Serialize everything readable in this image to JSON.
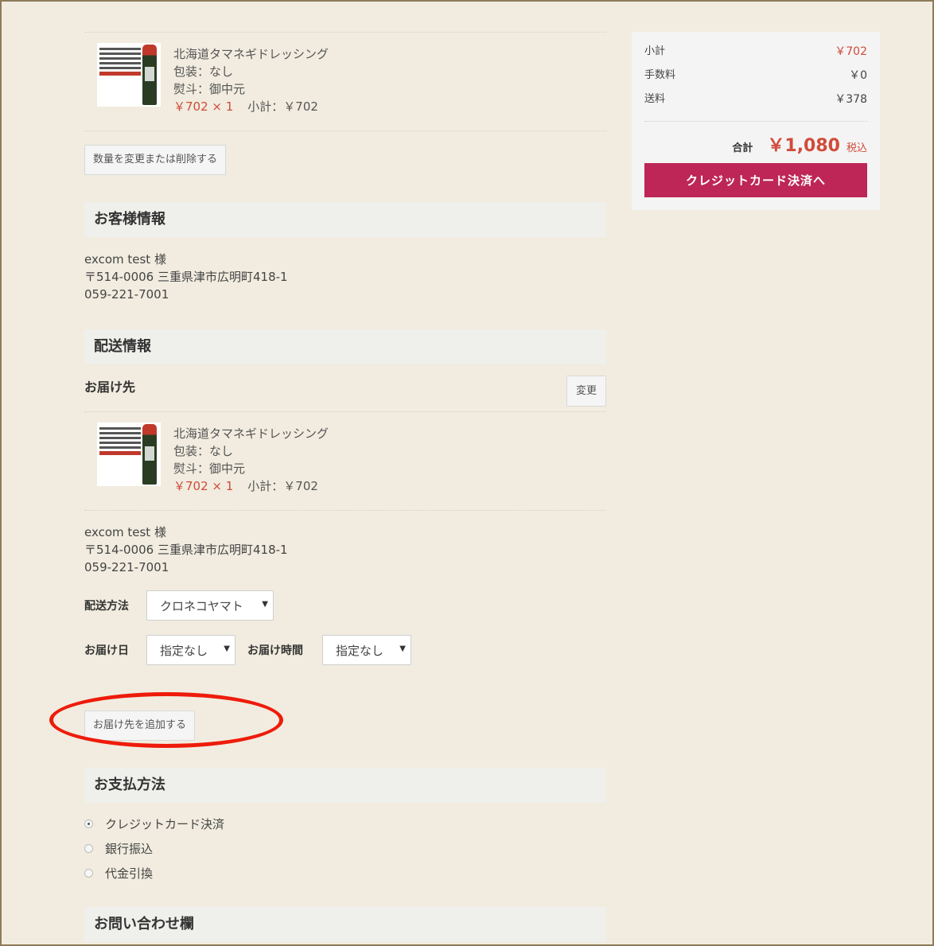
{
  "cart_item": {
    "name": "北海道タマネギドレッシング",
    "wrapping": "包装：なし",
    "noshi": "熨斗：御中元",
    "price_qty": "￥702 × 1",
    "subtotal": "小計：￥702"
  },
  "change_qty_button": "数量を変更または削除する",
  "customer": {
    "heading": "お客様情報",
    "name": "excom test 様",
    "address": "〒514-0006 三重県津市広明町418-1",
    "phone": "059-221-7001"
  },
  "shipping": {
    "heading": "配送情報",
    "destination_title": "お届け先",
    "change_button": "変更",
    "item": {
      "name": "北海道タマネギドレッシング",
      "wrapping": "包装：なし",
      "noshi": "熨斗：御中元",
      "price_qty": "￥702 × 1",
      "subtotal": "小計：￥702"
    },
    "name": "excom test 様",
    "address": "〒514-0006 三重県津市広明町418-1",
    "phone": "059-221-7001",
    "method_label": "配送方法",
    "method_value": "クロネコヤマト",
    "date_label": "お届け日",
    "date_value": "指定なし",
    "time_label": "お届け時間",
    "time_value": "指定なし",
    "add_destination_button": "お届け先を追加する"
  },
  "payment": {
    "heading": "お支払方法",
    "options": [
      {
        "label": "クレジットカード決済",
        "selected": true
      },
      {
        "label": "銀行振込",
        "selected": false
      },
      {
        "label": "代金引換",
        "selected": false
      }
    ]
  },
  "inquiry": {
    "heading": "お問い合わせ欄"
  },
  "summary": {
    "subtotal_label": "小計",
    "subtotal_value": "￥702",
    "fee_label": "手数料",
    "fee_value": "￥0",
    "shipping_label": "送料",
    "shipping_value": "￥378",
    "total_label": "合計",
    "total_value": "￥1,080",
    "tax_label": "税込",
    "pay_button": "クレジットカード決済へ"
  },
  "colors": {
    "accent": "#bd2657",
    "price": "#d04b3a",
    "annotation": "#ee1b0b",
    "background": "#f1ecdf"
  }
}
